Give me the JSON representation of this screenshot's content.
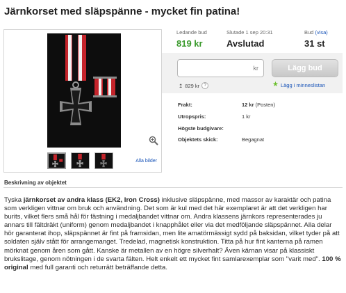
{
  "title": "Järnkorset med släpspänne - mycket fin patina!",
  "photo": {
    "all_images_link": "Alla bilder",
    "thumbnail_count": 3
  },
  "stats": {
    "leading_bid": {
      "label": "Ledande bud",
      "value": "819 kr"
    },
    "ends": {
      "label": "Slutade",
      "sublabel": "1 sep 20:31",
      "value": "Avslutad"
    },
    "bids": {
      "label": "Bud",
      "link": "(visa)",
      "value": "31 st"
    }
  },
  "bid_form": {
    "currency": "kr",
    "button_label": "Lägg bud",
    "hint_value": "829 kr",
    "help": "?",
    "watchlist_label": "Lägg i minneslistan"
  },
  "details": [
    {
      "label": "Frakt:",
      "value_bold": "12 kr",
      "value": " (Posten)"
    },
    {
      "label": "Utropspris:",
      "value_bold": "",
      "value": "1 kr"
    },
    {
      "label": "Högste budgivare:",
      "value_bold": "",
      "value": ""
    },
    {
      "label": "Objektets skick:",
      "value_bold": "",
      "value": "Begagnat"
    }
  ],
  "description": {
    "section_title": "Beskrivning av objektet",
    "text_1": "Tyska ",
    "bold_1": "järnkorset av andra klass (EK2, Iron Cross)",
    "text_2": " inklusive släpspänne, med massor av karaktär och patina som verkligen vittnar om bruk och användning. Det som är kul med det här exemplaret är att det verkligen har burits, vilket flers små hål för fästning i medaljbandet vittnar om. Andra klassens järnkors representerades ju annars till fältdräkt (uniform) genom medaljbandet i knapphålet eller via det medföljande släpspännet. Alla delar hör garanterat ihop, släpspännet är fint på framsidan, men lite amatörmässigt sydd på baksidan, vilket tyder på att soldaten själv stått för arrangemanget. Tredelad, magnetisk konstruktion. Titta på hur fint kanterna på ramen mörknat genom åren som gått. Kanske är metallen av en högre silverhalt? Även kärnan visar på klassiskt brukslitage, genom nötningen i de svarta fälten. Helt enkelt ett mycket fint samlarexemplar som \"varit med\". ",
    "bold_2": "100 % original",
    "text_3": " med full garanti och returrätt beträffande detta."
  },
  "colors": {
    "accent_green": "#3a9a2c",
    "link_blue": "#1a55b8",
    "ribbon_red": "#c4242b"
  }
}
